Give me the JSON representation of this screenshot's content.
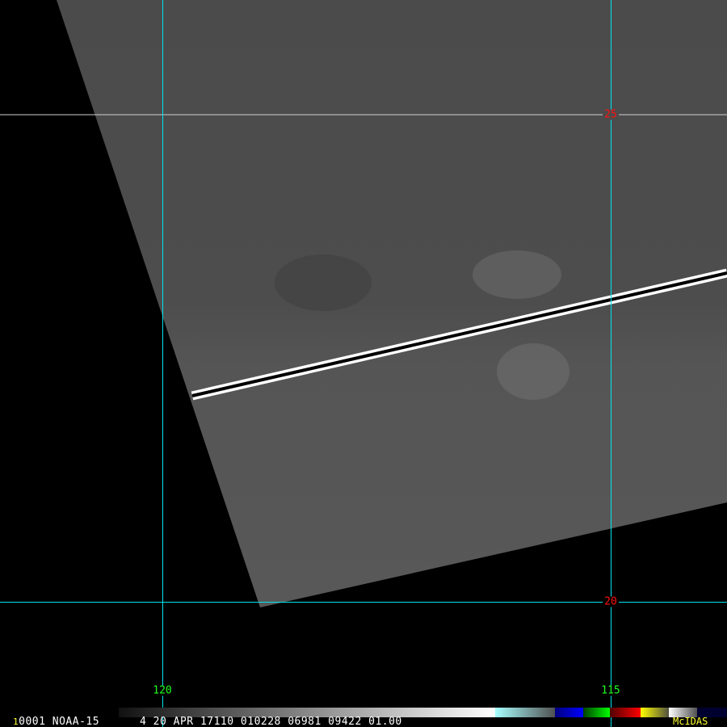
{
  "image": {
    "satellite_line": "0001 NOAA-15",
    "frame_number": "1",
    "datetime_info": "4 20 APR 17110 010228 06981 09422 01.00",
    "software_label": "McIDAS"
  },
  "grid": {
    "latitude_labels": [
      "25",
      "20"
    ],
    "longitude_labels": [
      "120",
      "115"
    ]
  },
  "colors": {
    "grid_line": "#00e5ee",
    "lat_label": "#ff1010",
    "lon_label": "#20ff20",
    "text_yellow": "#ffff30"
  }
}
